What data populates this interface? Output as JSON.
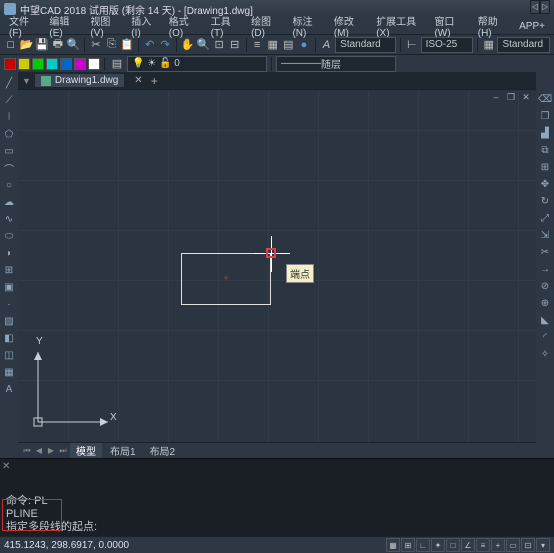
{
  "titlebar": {
    "text": "中望CAD 2018 试用版 (剩余 14 天) - [Drawing1.dwg]"
  },
  "menu": [
    "文件(F)",
    "编辑(E)",
    "视图(V)",
    "插入(I)",
    "格式(O)",
    "工具(T)",
    "绘图(D)",
    "标注(N)",
    "修改(M)",
    "扩展工具(X)",
    "窗口(W)",
    "帮助(H)",
    "APP+"
  ],
  "toolbar1": {
    "style_label": "Standard",
    "dimstyle_label": "ISO-25",
    "tablestyle_label": "Standard"
  },
  "toolbar2": {
    "layer_label": "随层"
  },
  "doctab": {
    "name": "Drawing1.dwg"
  },
  "canvas": {
    "tooltip": "端点",
    "ucs_x": "X",
    "ucs_y": "Y"
  },
  "layout": {
    "tabs": [
      "模型",
      "布局1",
      "布局2"
    ]
  },
  "cmd": {
    "line1": "命令: PL",
    "line2": "PLINE",
    "prompt": "指定多段线的起点:"
  },
  "status": {
    "coords": "415.1243, 298.6917, 0.0000"
  }
}
